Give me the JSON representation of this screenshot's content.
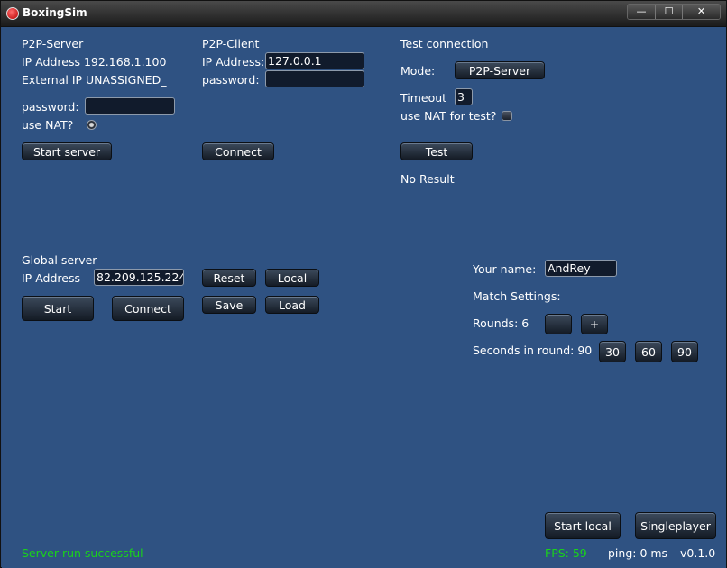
{
  "window": {
    "title": "BoxingSim",
    "min": "—",
    "max": "☐",
    "close": "✕"
  },
  "p2p_server": {
    "heading": "P2P-Server",
    "ip_label": "IP Address 192.168.1.100",
    "external_label": "External IP UNASSIGNED_",
    "password_label": "password:",
    "password_value": "",
    "nat_label": "use NAT?",
    "start_button": "Start server"
  },
  "p2p_client": {
    "heading": "P2P-Client",
    "ip_label": "IP Address:",
    "ip_value": "127.0.0.1",
    "password_label": "password:",
    "password_value": "",
    "connect_button": "Connect"
  },
  "test_connection": {
    "heading": "Test connection",
    "mode_label": "Mode:",
    "mode_value": "P2P-Server",
    "timeout_label": "Timeout",
    "timeout_value": "3",
    "nat_label": "use NAT for test?",
    "test_button": "Test",
    "result": "No Result"
  },
  "global_server": {
    "heading": "Global server",
    "ip_label": "IP Address",
    "ip_value": "82.209.125.224",
    "reset_button": "Reset",
    "local_button": "Local",
    "save_button": "Save",
    "load_button": "Load",
    "start_button": "Start",
    "connect_button": "Connect"
  },
  "match": {
    "name_label": "Your name:",
    "name_value": "AndRey",
    "settings_label": "Match Settings:",
    "rounds_label": "Rounds: 6",
    "minus_button": "-",
    "plus_button": "+",
    "seconds_label": "Seconds in round: 90",
    "sec_30": "30",
    "sec_60": "60",
    "sec_90": "90"
  },
  "bottom": {
    "start_local_button": "Start local",
    "singleplayer_button": "Singleplayer",
    "status": "Server run successful",
    "fps": "FPS: 59",
    "ping": "ping: 0 ms",
    "version": "v0.1.0"
  }
}
